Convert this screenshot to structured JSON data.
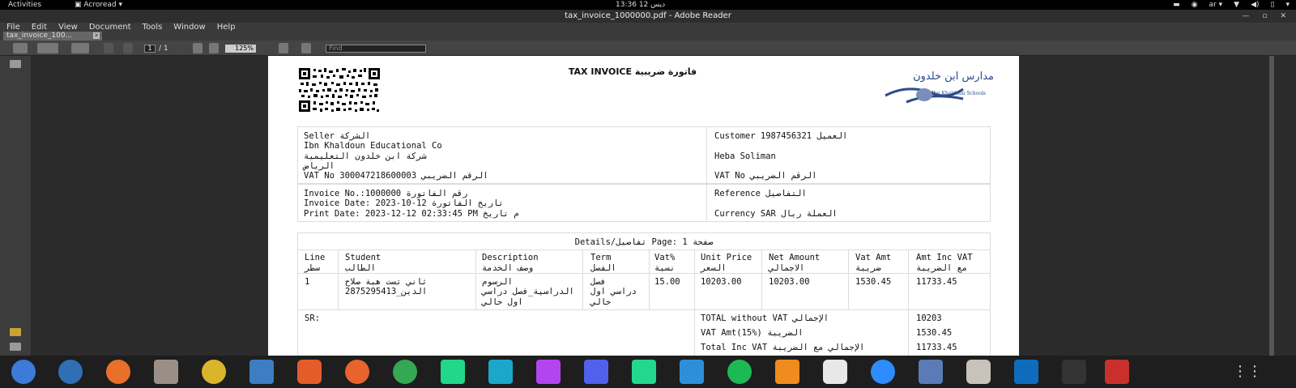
{
  "system_bar": {
    "activities": "Activities",
    "app_menu": "Acroread",
    "clock": "ديس 12  13:36",
    "lang": "ar"
  },
  "window": {
    "title": "tax_invoice_1000000.pdf - Adobe Reader"
  },
  "menu": [
    "File",
    "Edit",
    "View",
    "Document",
    "Tools",
    "Window",
    "Help"
  ],
  "tab": {
    "label": "tax_invoice_100..."
  },
  "toolbar": {
    "page_current": "1",
    "page_total": "/  1",
    "zoom": "125%",
    "find_placeholder": "Find"
  },
  "invoice": {
    "title": "TAX INVOICE فاتورة ضريبية",
    "logo_text_ar": "مدارس ابن خلدون",
    "logo_text_en": "Ibn Khaldoun Schools",
    "seller": {
      "label": "Seller الشركة",
      "name_en": "Ibn Khaldoun Educational Co",
      "name_ar": "شركة ابن خلدون التعليمية",
      "city": "الرياض",
      "vat": "VAT No 300047218600003 الرقم الضريبي"
    },
    "customer": {
      "label": "Customer 1987456321 العميل",
      "name": "Heba Soliman",
      "vat": "VAT No الرقم الضريبي"
    },
    "meta": {
      "invoice_no": "Invoice No.:1000000 رقم الفاتورة",
      "invoice_date": "Invoice Date: 2023-10-12 تاريخ الفاتورة",
      "print_date": "Print Date: 2023-12-12 02:33:45 PM م تاريخ"
    },
    "ref": {
      "reference": "Reference التفاصيل",
      "currency": "Currency SAR العملة ريال"
    },
    "details_title": "Details/تفاصيل Page: 1 صفحة",
    "columns": [
      {
        "en": "Line",
        "ar": "سطر"
      },
      {
        "en": "Student",
        "ar": "الطالب"
      },
      {
        "en": "Description",
        "ar": "وصف الخدمة"
      },
      {
        "en": "Term",
        "ar": "الفصل"
      },
      {
        "en": "Vat%",
        "ar": "نسبة"
      },
      {
        "en": "Unit Price",
        "ar": "السعر"
      },
      {
        "en": "Net Amount",
        "ar": "الاجمالي"
      },
      {
        "en": "Vat Amt",
        "ar": "ضريبة"
      },
      {
        "en": "Amt Inc VAT",
        "ar": "مع الضريبة"
      }
    ],
    "row": {
      "line": "1",
      "student1": "ثاني تست هبة صلاح",
      "student2": "2875295413_الدين",
      "desc1": "الرسوم",
      "desc2": "الدراسية_فصل دراسي",
      "desc3": "اول حالي",
      "term1": "فصل",
      "term2": "دراسي اول",
      "term3": "حالي",
      "vat": "15.00",
      "unit": "10203.00",
      "net": "10203.00",
      "vat_amt": "1530.45",
      "inc": "11733.45"
    },
    "sr_label": "SR:",
    "totals": [
      {
        "label": "TOTAL without VAT الإجمالي",
        "value": "10203"
      },
      {
        "label": "VAT Amt(15%) الضريبة",
        "value": "1530.45"
      },
      {
        "label": "Total Inc VAT الإجمالي مع الضريبة",
        "value": "11733.45"
      }
    ]
  },
  "colors": {
    "taskbar": "#1e1e1e",
    "logo_blue": "#2b4a8c"
  }
}
